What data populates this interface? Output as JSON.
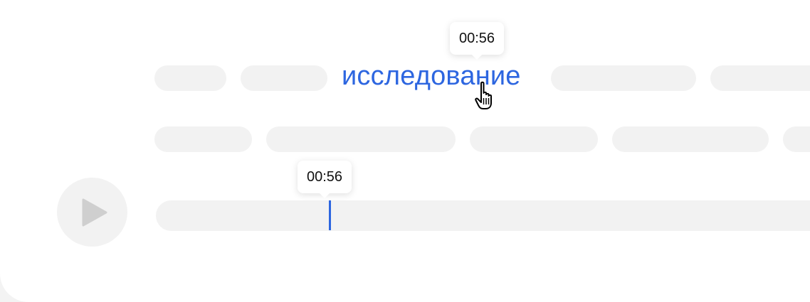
{
  "transcript": {
    "highlighted_word": "исследование",
    "word_tooltip_time": "00:56"
  },
  "player": {
    "playhead_tooltip_time": "00:56",
    "play_icon": "play-icon",
    "pointer_icon": "hand-pointer-icon"
  },
  "colors": {
    "accent": "#2d66e0",
    "placeholder": "#f2f2f2",
    "background": "#ffffff"
  }
}
